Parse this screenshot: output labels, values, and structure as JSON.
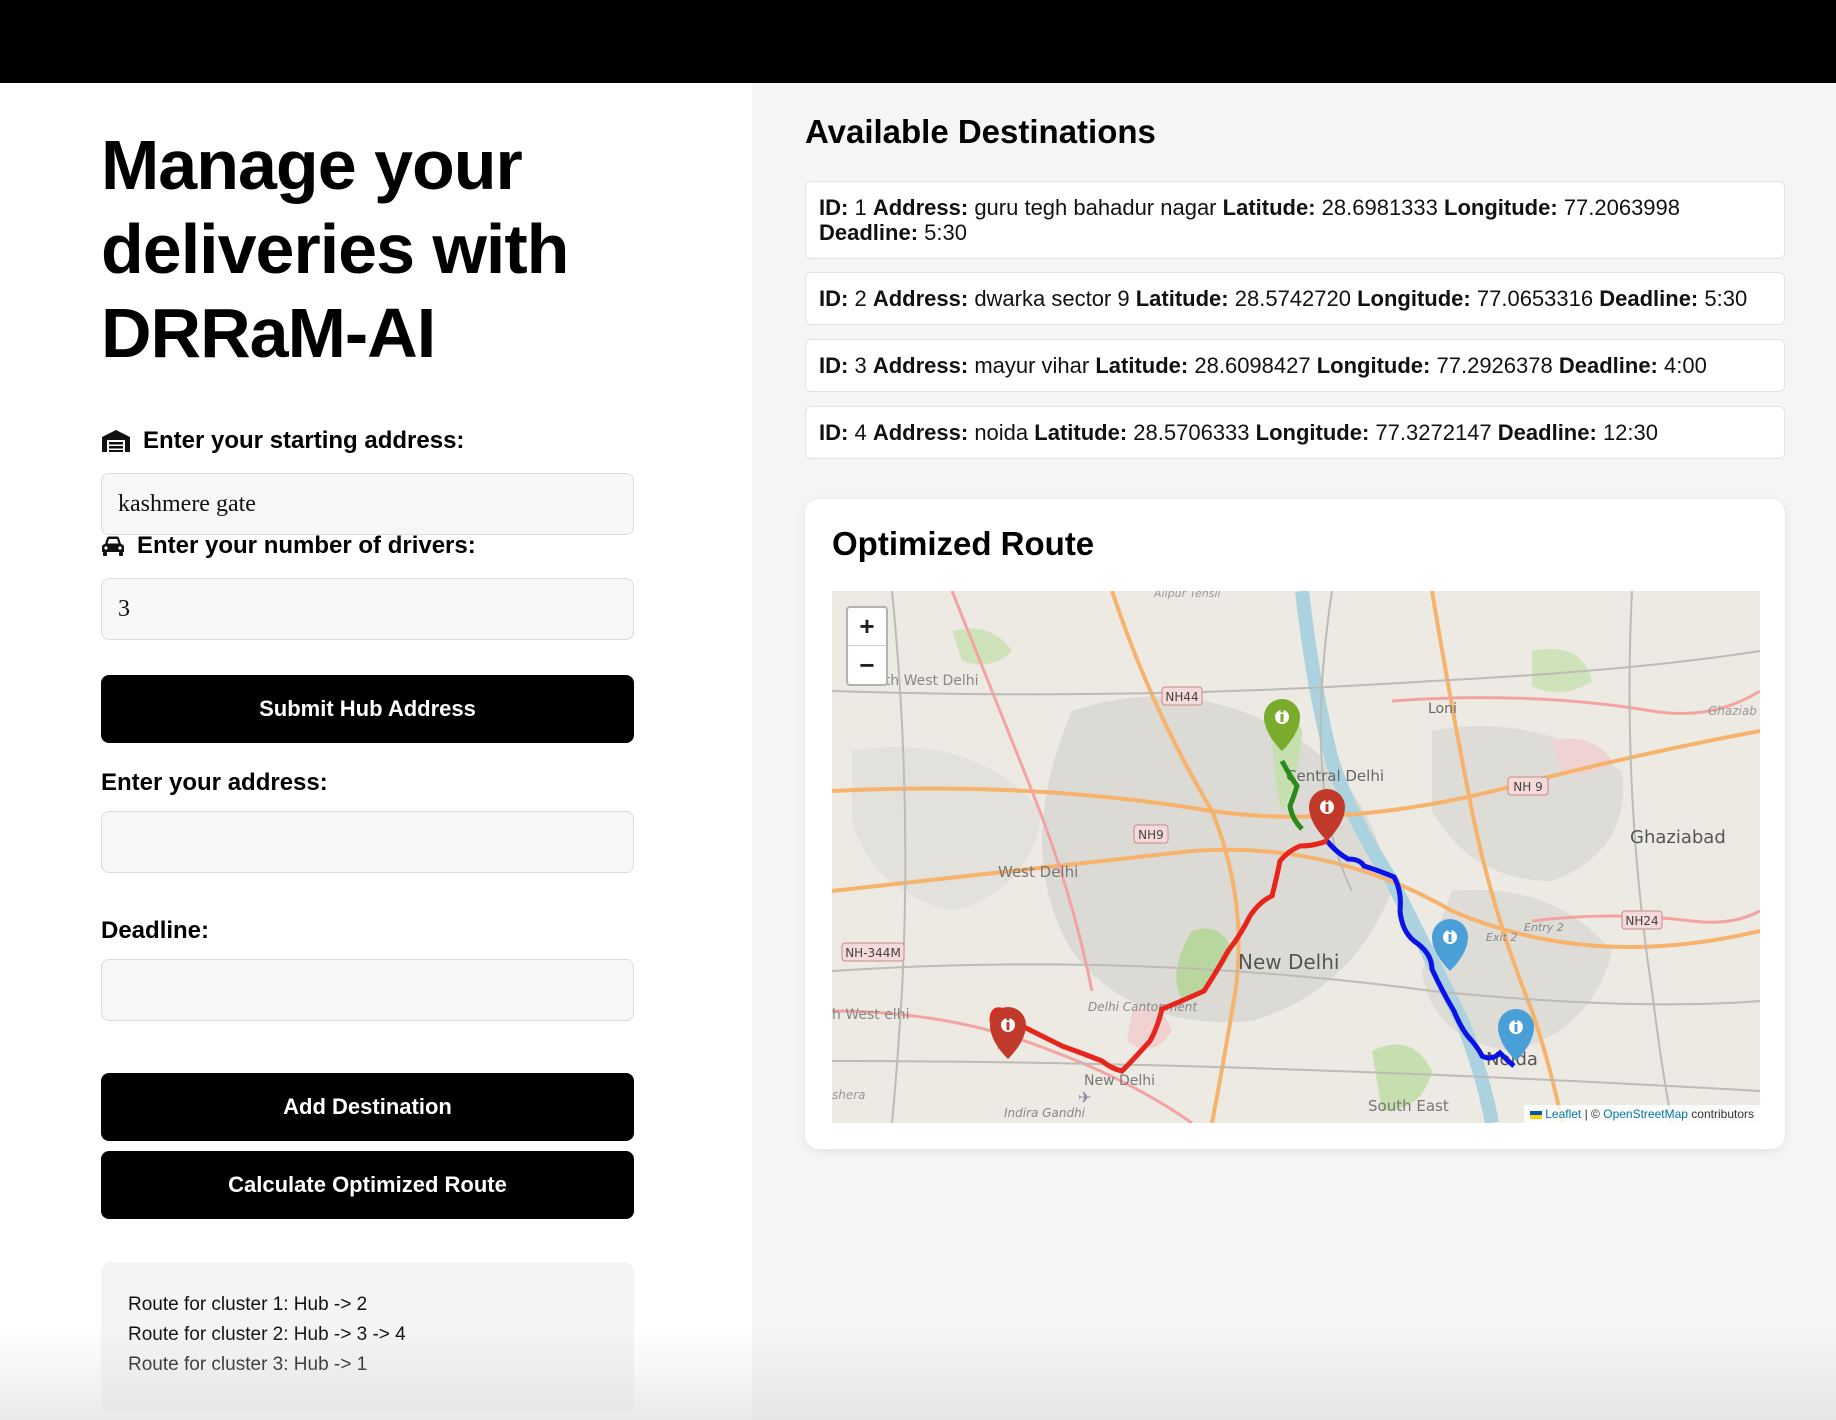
{
  "hero": {
    "line1": "Manage your",
    "line2": "deliveries with",
    "line3": "DRRaM-AI"
  },
  "form": {
    "start_label": "Enter your starting address:",
    "start_value": "kashmere gate",
    "drivers_label": "Enter your number of drivers:",
    "drivers_value": "3",
    "submit_hub_label": "Submit Hub Address",
    "address_label": "Enter your address:",
    "address_value": "",
    "deadline_label": "Deadline:",
    "deadline_value": "",
    "add_destination_label": "Add Destination",
    "calculate_label": "Calculate Optimized Route"
  },
  "routes": [
    "Route for cluster 1: Hub -> 2",
    "Route for cluster 2: Hub -> 3 -> 4",
    "Route for cluster 3: Hub -> 1"
  ],
  "destinations_title": "Available Destinations",
  "field_labels": {
    "id": "ID:",
    "address": "Address:",
    "latitude": "Latitude:",
    "longitude": "Longitude:",
    "deadline": "Deadline:"
  },
  "destinations": [
    {
      "id": "1",
      "address": "guru tegh bahadur nagar",
      "latitude": "28.6981333",
      "longitude": "77.2063998",
      "deadline": "5:30"
    },
    {
      "id": "2",
      "address": "dwarka sector 9",
      "latitude": "28.5742720",
      "longitude": "77.0653316",
      "deadline": "5:30"
    },
    {
      "id": "3",
      "address": "mayur vihar",
      "latitude": "28.6098427",
      "longitude": "77.2926378",
      "deadline": "4:00"
    },
    {
      "id": "4",
      "address": "noida",
      "latitude": "28.5706333",
      "longitude": "77.3272147",
      "deadline": "12:30"
    }
  ],
  "map_section": {
    "title": "Optimized Route",
    "zoom_in": "+",
    "zoom_out": "−",
    "places": {
      "central_delhi": "Central Delhi",
      "new_delhi": "New Delhi",
      "west_delhi": "West Delhi",
      "ghaziabad": "Ghaziabad",
      "loni": "Loni",
      "noida": "Noida",
      "south_east": "South East",
      "delhi_cantonment": "Delhi Cantonment",
      "new_delhi_small": "New Delhi",
      "north_west": "North West Delhi",
      "south_west": "h West elhi",
      "indira_gandhi": "Indira Gandhi",
      "ghaziab_edge": "Ghaziab",
      "alipur": "Alipur Tehsil",
      "najafgarh": "shera",
      "exit2": "Exit 2",
      "entry2": "Entry 2"
    },
    "roads": {
      "nh44": "NH44",
      "nh9a": "NH9",
      "nh9b": "NH 9",
      "nh24": "NH24",
      "nh344m": "NH-344M"
    },
    "attribution": {
      "leaflet": "Leaflet",
      "osm": "OpenStreetMap",
      "rest": "contributors",
      "sep": "| ©"
    },
    "route_colors": {
      "cluster1": "#e8251c",
      "cluster2": "#0a12e8",
      "cluster3": "#2a8a1a"
    },
    "marker_colors": {
      "hub": "#c0392b",
      "dest1": "#7aab2a",
      "dest2": "#c0392b",
      "dest3": "#4a9fd6",
      "dest4": "#4a9fd6"
    }
  },
  "icons": {
    "start_icon": "warehouse-icon",
    "drivers_icon": "car-icon",
    "marker_icon": "info-marker-icon"
  }
}
